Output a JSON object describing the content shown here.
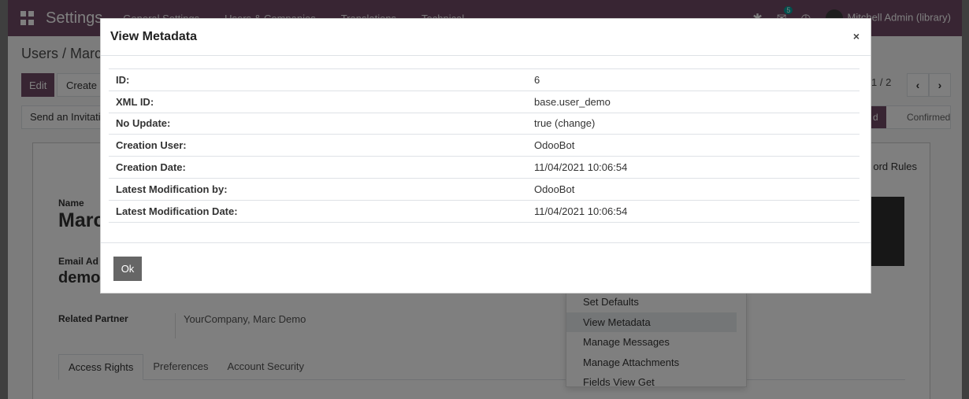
{
  "navbar": {
    "brand": "Settings",
    "menus": [
      "General Settings",
      "Users & Companies",
      "Translations",
      "Technical"
    ],
    "messages_count": "5",
    "user": "Mitchell Admin (library)"
  },
  "control": {
    "breadcrumb": "Users / Marc",
    "edit_label": "Edit",
    "create_label": "Create",
    "pager": "1 / 2",
    "prev_icon": "‹",
    "next_icon": "›",
    "invite_label": "Send an Invitati",
    "status_active": "d",
    "status_confirmed": "Confirmed"
  },
  "form": {
    "record_rules": "ord Rules",
    "name_label": "Name",
    "name_value": "Marc",
    "email_label": "Email Ad",
    "email_value": "demo",
    "partner_label": "Related Partner",
    "partner_value": "YourCompany, Marc Demo",
    "tabs": [
      "Access Rights",
      "Preferences",
      "Account Security"
    ]
  },
  "dropdown": {
    "items": [
      "Set Defaults",
      "View Metadata",
      "Manage Messages",
      "Manage Attachments",
      "Fields View Get"
    ]
  },
  "modal": {
    "title": "View Metadata",
    "close_icon": "×",
    "rows": [
      {
        "key": "ID:",
        "value": "6"
      },
      {
        "key": "XML ID:",
        "value": "base.user_demo"
      },
      {
        "key": "No Update:",
        "value": "true (change)"
      },
      {
        "key": "Creation User:",
        "value": "OdooBot"
      },
      {
        "key": "Creation Date:",
        "value": "11/04/2021 10:06:54"
      },
      {
        "key": "Latest Modification by:",
        "value": "OdooBot"
      },
      {
        "key": "Latest Modification Date:",
        "value": "11/04/2021 10:06:54"
      }
    ],
    "ok_label": "Ok"
  }
}
